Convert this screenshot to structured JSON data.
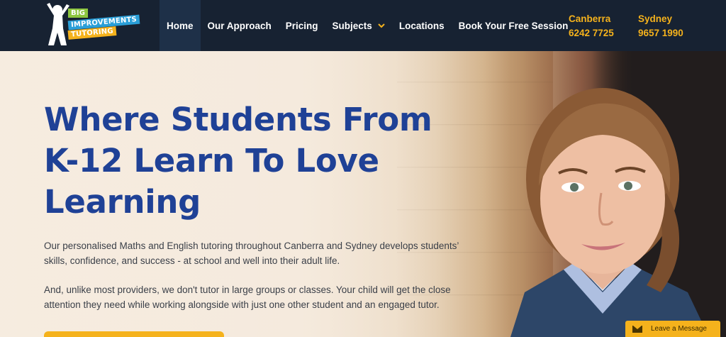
{
  "logo": {
    "line1": "BIG",
    "line2": "IMPROVEMENTS",
    "line3": "TUTORING"
  },
  "nav": {
    "items": [
      {
        "label": "Home",
        "active": true
      },
      {
        "label": "Our Approach"
      },
      {
        "label": "Pricing"
      },
      {
        "label": "Subjects",
        "has_dropdown": true
      },
      {
        "label": "Locations"
      },
      {
        "label": "Book Your Free Session"
      }
    ],
    "chevron": "⌄"
  },
  "contacts": {
    "canberra": {
      "city": "Canberra",
      "phone": "6242 7725"
    },
    "sydney": {
      "city": "Sydney",
      "phone": "9657 1990"
    }
  },
  "hero": {
    "headline": "Where Students From K-12 Learn To Love Learning",
    "paragraph1": "Our personalised Maths and English tutoring throughout Canberra and Sydney develops students’ skills, confidence, and success - at school and well into their adult life.",
    "paragraph2": "And, unlike most providers, we don't tutor in large groups or classes. Your child will get the close attention they need while working alongside with just one other student and an engaged tutor."
  },
  "chat": {
    "label": "Leave a Message",
    "icon": "envelope-icon"
  },
  "colors": {
    "nav_bg": "#172232",
    "accent": "#f5b21c",
    "headline": "#1f4196",
    "logo_green": "#8dc63f",
    "logo_blue": "#2a9fd8"
  }
}
